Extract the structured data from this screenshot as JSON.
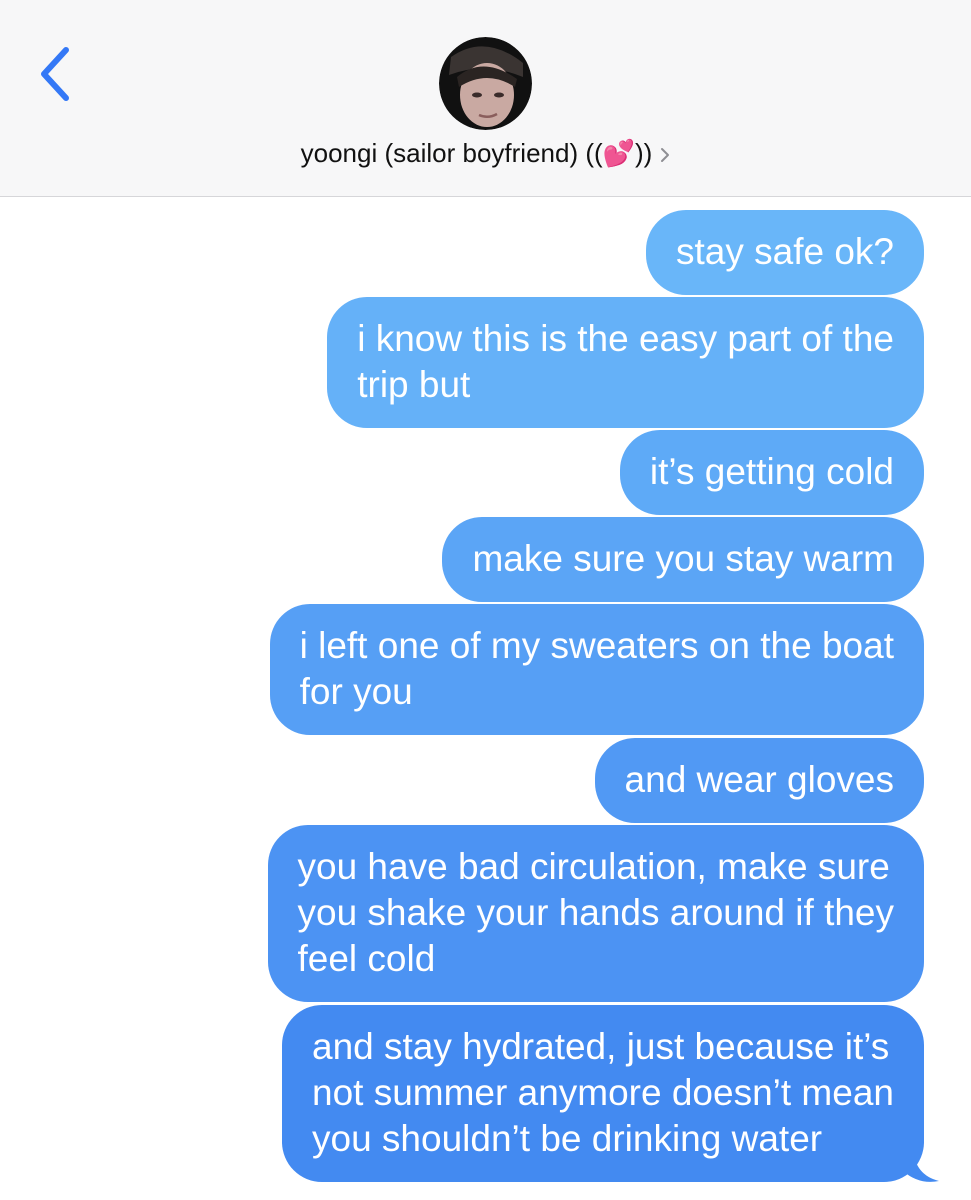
{
  "header": {
    "back_icon": "chevron-left-icon",
    "avatar_icon": "contact-avatar",
    "contact_name": "yoongi (sailor boyfriend) ((💕))",
    "chevron_icon": "chevron-right-icon"
  },
  "colors": {
    "accent": "#3478f6",
    "bubble_top": "#69b7f9",
    "bubble_bottom": "#3f86f0"
  },
  "messages": [
    {
      "text": "stay safe ok?"
    },
    {
      "text": "i know this is the easy part of the\ntrip but"
    },
    {
      "text": "it’s getting cold"
    },
    {
      "text": "make sure you stay warm"
    },
    {
      "text": "i left one of my sweaters on the boat\nfor you"
    },
    {
      "text": "and wear gloves"
    },
    {
      "text": "you have bad circulation, make sure\nyou shake your hands around if they\nfeel cold"
    },
    {
      "text": "and stay hydrated, just because it’s\nnot summer anymore doesn’t mean\nyou shouldn’t be drinking water"
    }
  ]
}
